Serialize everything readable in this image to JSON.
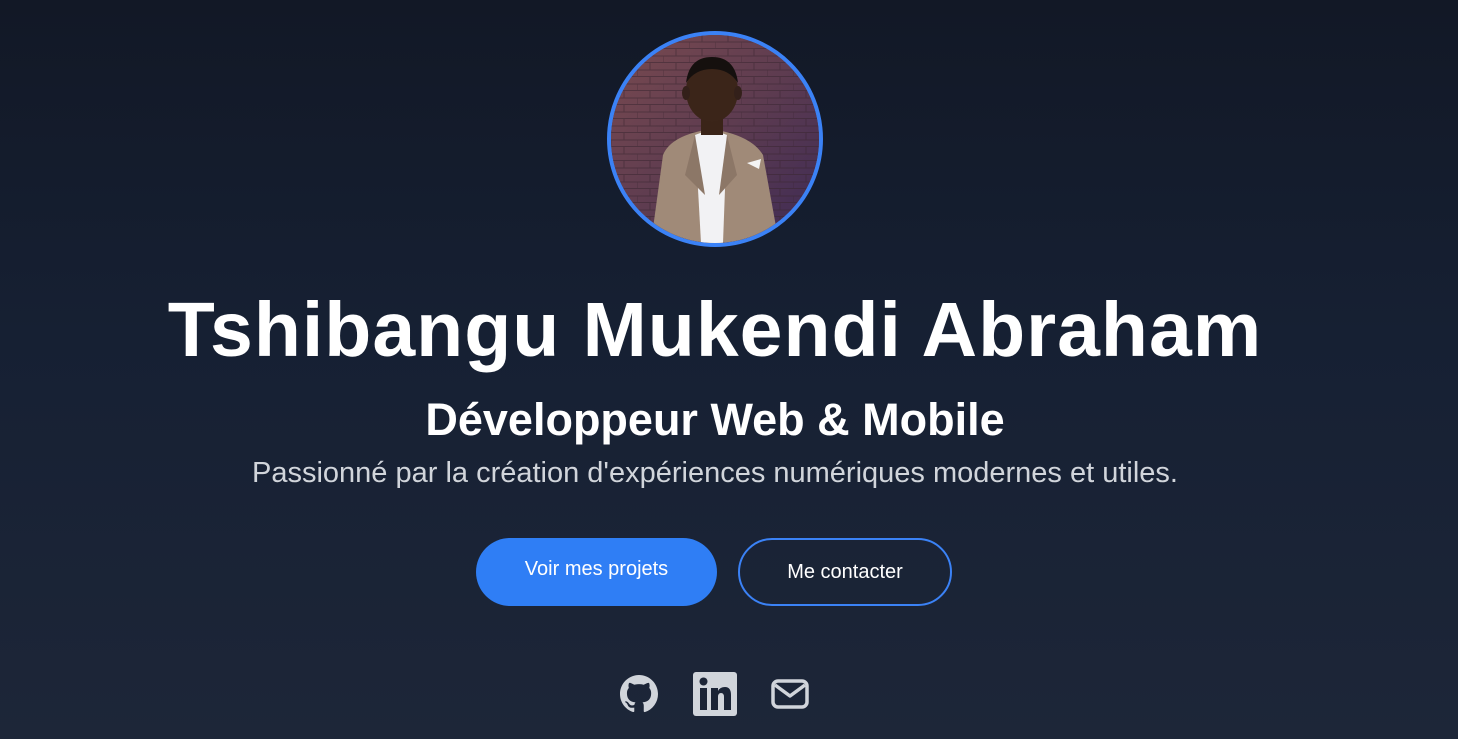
{
  "profile": {
    "photo_alt": "photo-profil",
    "name": "Tshibangu Mukendi Abraham",
    "role": "Développeur Web & Mobile",
    "tagline": "Passionné par la création d'expériences numériques modernes et utiles."
  },
  "actions": {
    "projects_label": "Voir mes projets",
    "contact_label": "Me contacter"
  },
  "socials": [
    {
      "icon": "github-icon",
      "label": "GitHub"
    },
    {
      "icon": "linkedin-icon",
      "label": "LinkedIn"
    },
    {
      "icon": "mail-icon",
      "label": "Email"
    }
  ],
  "colors": {
    "accent": "#3b82f6",
    "background_top": "#121826",
    "background_bottom": "#1d2638",
    "text_muted": "#d1d5db",
    "icon": "#d1d5db"
  }
}
